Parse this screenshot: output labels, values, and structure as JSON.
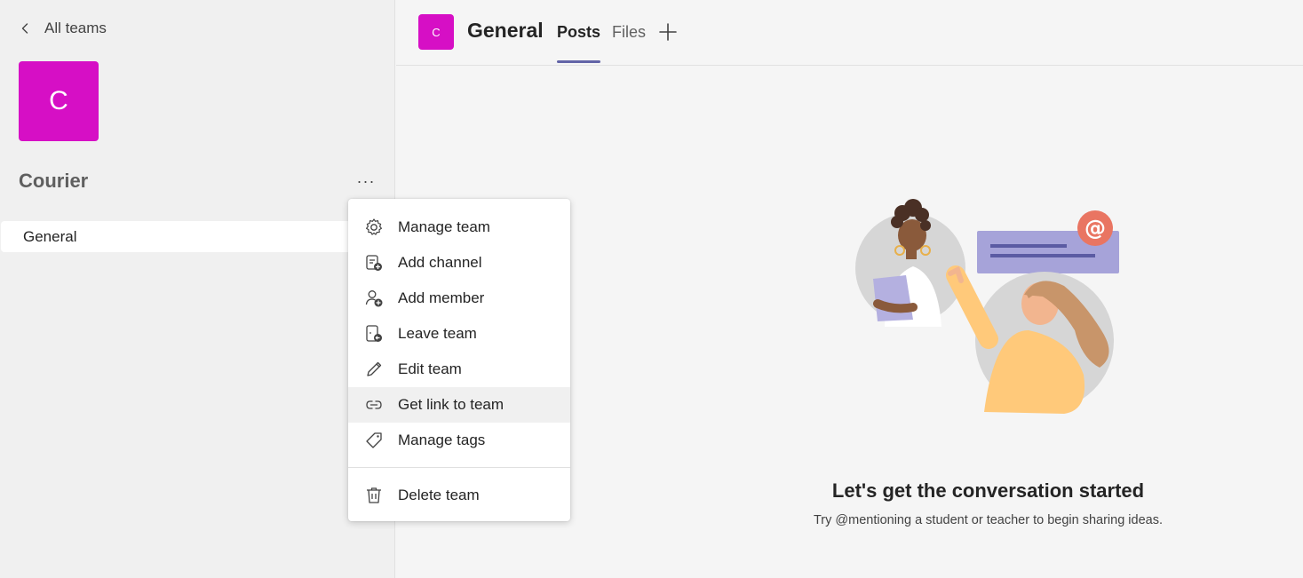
{
  "colors": {
    "team_accent": "#d60fc5",
    "tab_underline": "#6264a7",
    "hover_bg": "#f0f0f0"
  },
  "sidebar": {
    "back_label": "All teams",
    "team_initial": "C",
    "team_name": "Courier",
    "more_label": "···",
    "channels": [
      {
        "label": "General"
      }
    ]
  },
  "header": {
    "channel_initial": "C",
    "channel_title": "General",
    "tabs": [
      {
        "label": "Posts",
        "active": true
      },
      {
        "label": "Files",
        "active": false
      }
    ]
  },
  "empty_state": {
    "title": "Let's get the conversation started",
    "subtitle": "Try @mentioning a student or teacher to begin sharing ideas."
  },
  "menu": {
    "items": [
      {
        "label": "Manage team",
        "icon": "gear-icon"
      },
      {
        "label": "Add channel",
        "icon": "add-channel-icon"
      },
      {
        "label": "Add member",
        "icon": "add-member-icon"
      },
      {
        "label": "Leave team",
        "icon": "leave-team-icon"
      },
      {
        "label": "Edit team",
        "icon": "pencil-icon"
      },
      {
        "label": "Get link to team",
        "icon": "link-icon",
        "highlighted": true
      },
      {
        "label": "Manage tags",
        "icon": "tag-icon"
      }
    ],
    "delete_item": {
      "label": "Delete team",
      "icon": "trash-icon"
    }
  }
}
